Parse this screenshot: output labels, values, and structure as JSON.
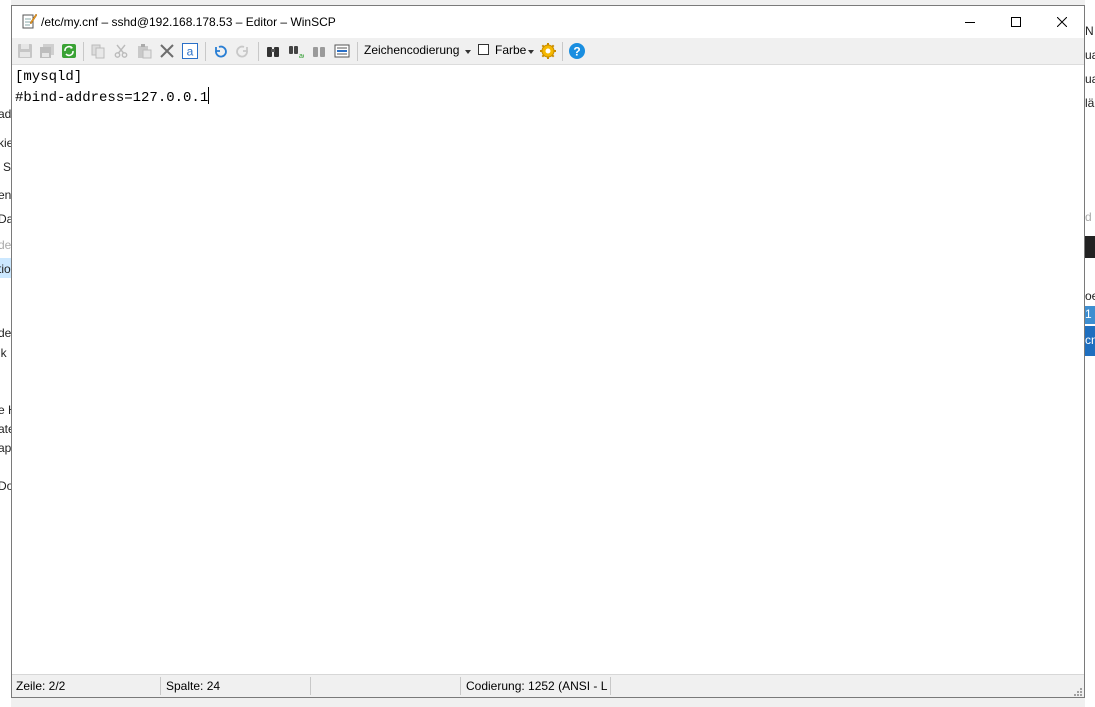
{
  "window": {
    "title": "/etc/my.cnf – sshd@192.168.178.53 – Editor – WinSCP",
    "controls": {
      "minimize": "minimize",
      "maximize": "maximize",
      "close": "close"
    }
  },
  "toolbar": {
    "buttons": [
      {
        "name": "save-icon",
        "tooltip": "Save"
      },
      {
        "name": "save-all-icon",
        "tooltip": "Save All"
      },
      {
        "name": "reload-icon",
        "tooltip": "Reload"
      },
      {
        "name": "copy-icon",
        "tooltip": "Copy"
      },
      {
        "name": "cut-icon",
        "tooltip": "Cut"
      },
      {
        "name": "paste-icon",
        "tooltip": "Paste"
      },
      {
        "name": "delete-icon",
        "tooltip": "Delete"
      },
      {
        "name": "select-all-icon",
        "tooltip": "Select All"
      },
      {
        "name": "undo-icon",
        "tooltip": "Undo"
      },
      {
        "name": "redo-icon",
        "tooltip": "Redo"
      },
      {
        "name": "find-icon",
        "tooltip": "Find"
      },
      {
        "name": "replace-icon",
        "tooltip": "Replace"
      },
      {
        "name": "find-next-icon",
        "tooltip": "Find Next"
      },
      {
        "name": "goto-line-icon",
        "tooltip": "Go to Line"
      }
    ],
    "encoding_label": "Zeichencodierung",
    "color_label": "Farbe",
    "color_checked": false,
    "settings_icon": "gear-icon",
    "help_icon": "help-icon"
  },
  "editor": {
    "lines": [
      "[mysqld]",
      "#bind-address=127.0.0.1"
    ]
  },
  "statusbar": {
    "line": "Zeile: 2/2",
    "column": "Spalte: 24",
    "modified": "",
    "encoding": "Codierung: 1252  (ANSI - L"
  },
  "background": {
    "left_fragments": [
      "ad",
      "kie",
      "S",
      "en",
      "Dat",
      "de",
      "tio",
      "de",
      "ik",
      "e H",
      "ate",
      "ap",
      "Do"
    ],
    "right_fragments": [
      "N",
      "ua",
      "ua",
      "lä",
      "d",
      "oe",
      "1",
      "cm"
    ]
  },
  "colors": {
    "accent": "#0078d7",
    "selection": "#3e8ed0"
  }
}
